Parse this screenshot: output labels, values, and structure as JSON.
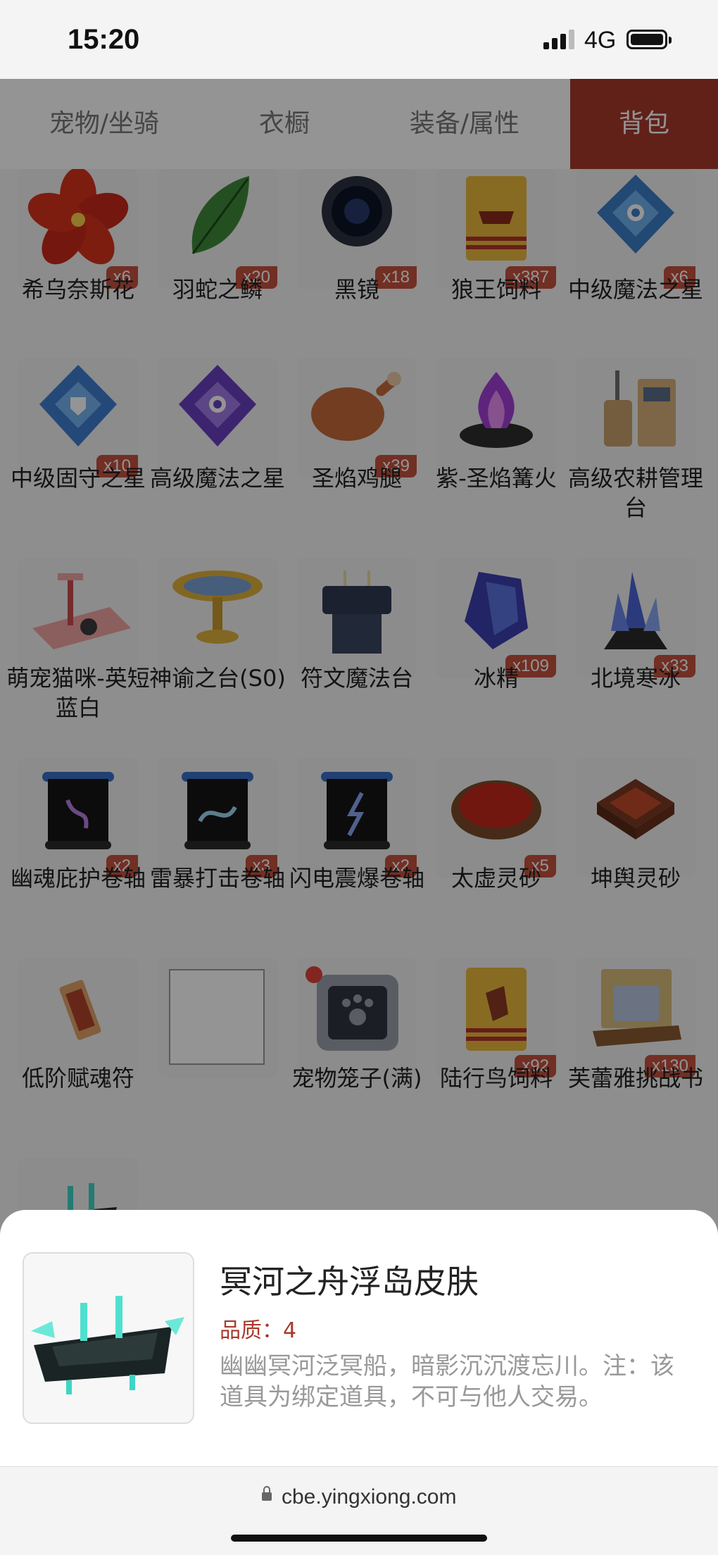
{
  "status": {
    "time": "15:20",
    "network": "4G"
  },
  "tabs": [
    {
      "label": "宠物/坐骑",
      "active": false
    },
    {
      "label": "衣橱",
      "active": false
    },
    {
      "label": "装备/属性",
      "active": false
    },
    {
      "label": "背包",
      "active": true
    }
  ],
  "items": [
    {
      "name": "希乌奈斯花",
      "qty": "x6",
      "icon": "red-flower"
    },
    {
      "name": "羽蛇之鳞",
      "qty": "x20",
      "icon": "green-scale"
    },
    {
      "name": "黑镜",
      "qty": "x18",
      "icon": "black-mirror"
    },
    {
      "name": "狼王饲料",
      "qty": "x387",
      "icon": "feed-bag"
    },
    {
      "name": "中级魔法之星",
      "qty": "x6",
      "icon": "blue-crystal"
    },
    {
      "name": "中级固守之星",
      "qty": "x10",
      "icon": "blue-shield-crystal"
    },
    {
      "name": "高级魔法之星",
      "qty": "",
      "icon": "purple-crystal"
    },
    {
      "name": "圣焰鸡腿",
      "qty": "x39",
      "icon": "chicken-leg"
    },
    {
      "name": "紫-圣焰篝火",
      "qty": "",
      "icon": "purple-bonfire"
    },
    {
      "name": "高级农耕管理台",
      "qty": "",
      "icon": "farm-console"
    },
    {
      "name": "萌宠猫咪-英短蓝白",
      "qty": "",
      "icon": "cat-tower"
    },
    {
      "name": "神谕之台(S0)",
      "qty": "",
      "icon": "oracle-altar"
    },
    {
      "name": "符文魔法台",
      "qty": "",
      "icon": "rune-table"
    },
    {
      "name": "冰精",
      "qty": "x109",
      "icon": "ice-crystal"
    },
    {
      "name": "北境寒冰",
      "qty": "x33",
      "icon": "ice-cluster"
    },
    {
      "name": "幽魂庇护卷轴",
      "qty": "x2",
      "icon": "scroll"
    },
    {
      "name": "雷暴打击卷轴",
      "qty": "x3",
      "icon": "scroll"
    },
    {
      "name": "闪电震爆卷轴",
      "qty": "x2",
      "icon": "scroll"
    },
    {
      "name": "太虚灵砂",
      "qty": "x5",
      "icon": "red-sand-bowl"
    },
    {
      "name": "坤舆灵砂",
      "qty": "",
      "icon": "red-sand-box"
    },
    {
      "name": "低阶赋魂符",
      "qty": "",
      "icon": "talisman"
    },
    {
      "name": "",
      "qty": "",
      "icon": "empty-slot"
    },
    {
      "name": "宠物笼子(满)",
      "qty": "",
      "icon": "pet-cage"
    },
    {
      "name": "陆行鸟饲料",
      "qty": "x92",
      "icon": "bird-feed-bag"
    },
    {
      "name": "芙蕾雅挑战书",
      "qty": "x130",
      "icon": "wanted-scroll"
    }
  ],
  "detail": {
    "title": "冥河之舟浮岛皮肤",
    "quality": "品质：4",
    "description": "幽幽冥河泛冥船，暗影沉沉渡忘川。注：该道具为绑定道具，不可与他人交易。",
    "icon": "ghost-ship"
  },
  "browser": {
    "url": "cbe.yingxiong.com"
  }
}
